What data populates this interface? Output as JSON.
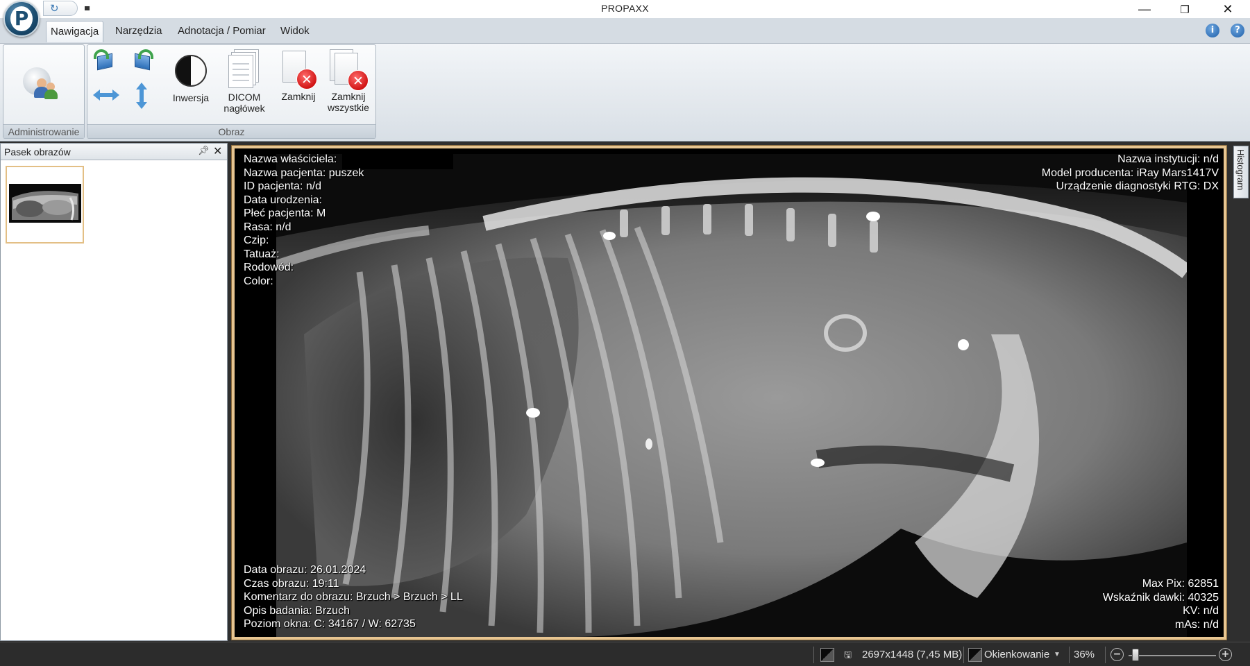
{
  "window": {
    "title": "PROPAXX"
  },
  "tabs": [
    {
      "label": "Nawigacja",
      "active": true
    },
    {
      "label": "Narzędzia",
      "active": false
    },
    {
      "label": "Adnotacja / Pomiar",
      "active": false
    },
    {
      "label": "Widok",
      "active": false
    }
  ],
  "ribbon": {
    "admin_group": {
      "label": "Administrowanie"
    },
    "image_group": {
      "label": "Obraz",
      "invert": "Inwersja",
      "dicom_line1": "DICOM",
      "dicom_line2": "nagłówek",
      "close": "Zamknij",
      "close_all_line1": "Zamknij",
      "close_all_line2": "wszystkie"
    }
  },
  "sidebar": {
    "title": "Pasek obrazów"
  },
  "overlay": {
    "top_left": [
      "Nazwa właściciela:",
      "Nazwa pacjenta: puszek",
      "ID pacjenta: n/d",
      "Data urodzenia:",
      "Płeć pacjenta: M",
      "Rasa: n/d",
      "Czip:",
      "Tatuaż:",
      "Rodowód:",
      "Color:"
    ],
    "top_right": [
      "Nazwa instytucji: n/d",
      "Model producenta: iRay Mars1417V",
      "Urządzenie diagnostyki RTG: DX"
    ],
    "bottom_left": [
      "Data obrazu: 26.01.2024",
      "Czas obrazu: 19:11",
      "Komentarz do obrazu: Brzuch > Brzuch > LL",
      "Opis badania: Brzuch",
      "Poziom okna: C: 34167 / W: 62735"
    ],
    "bottom_right": [
      "Max Pix: 62851",
      "Wskaźnik dawki: 40325",
      "KV: n/d",
      "mAs: n/d"
    ]
  },
  "histogram_tab": "Histogram",
  "status": {
    "dimensions": "2697x1448 (7,45 MB)",
    "mode": "Okienkowanie",
    "zoom": "36%",
    "zoom_level": 0.08
  }
}
